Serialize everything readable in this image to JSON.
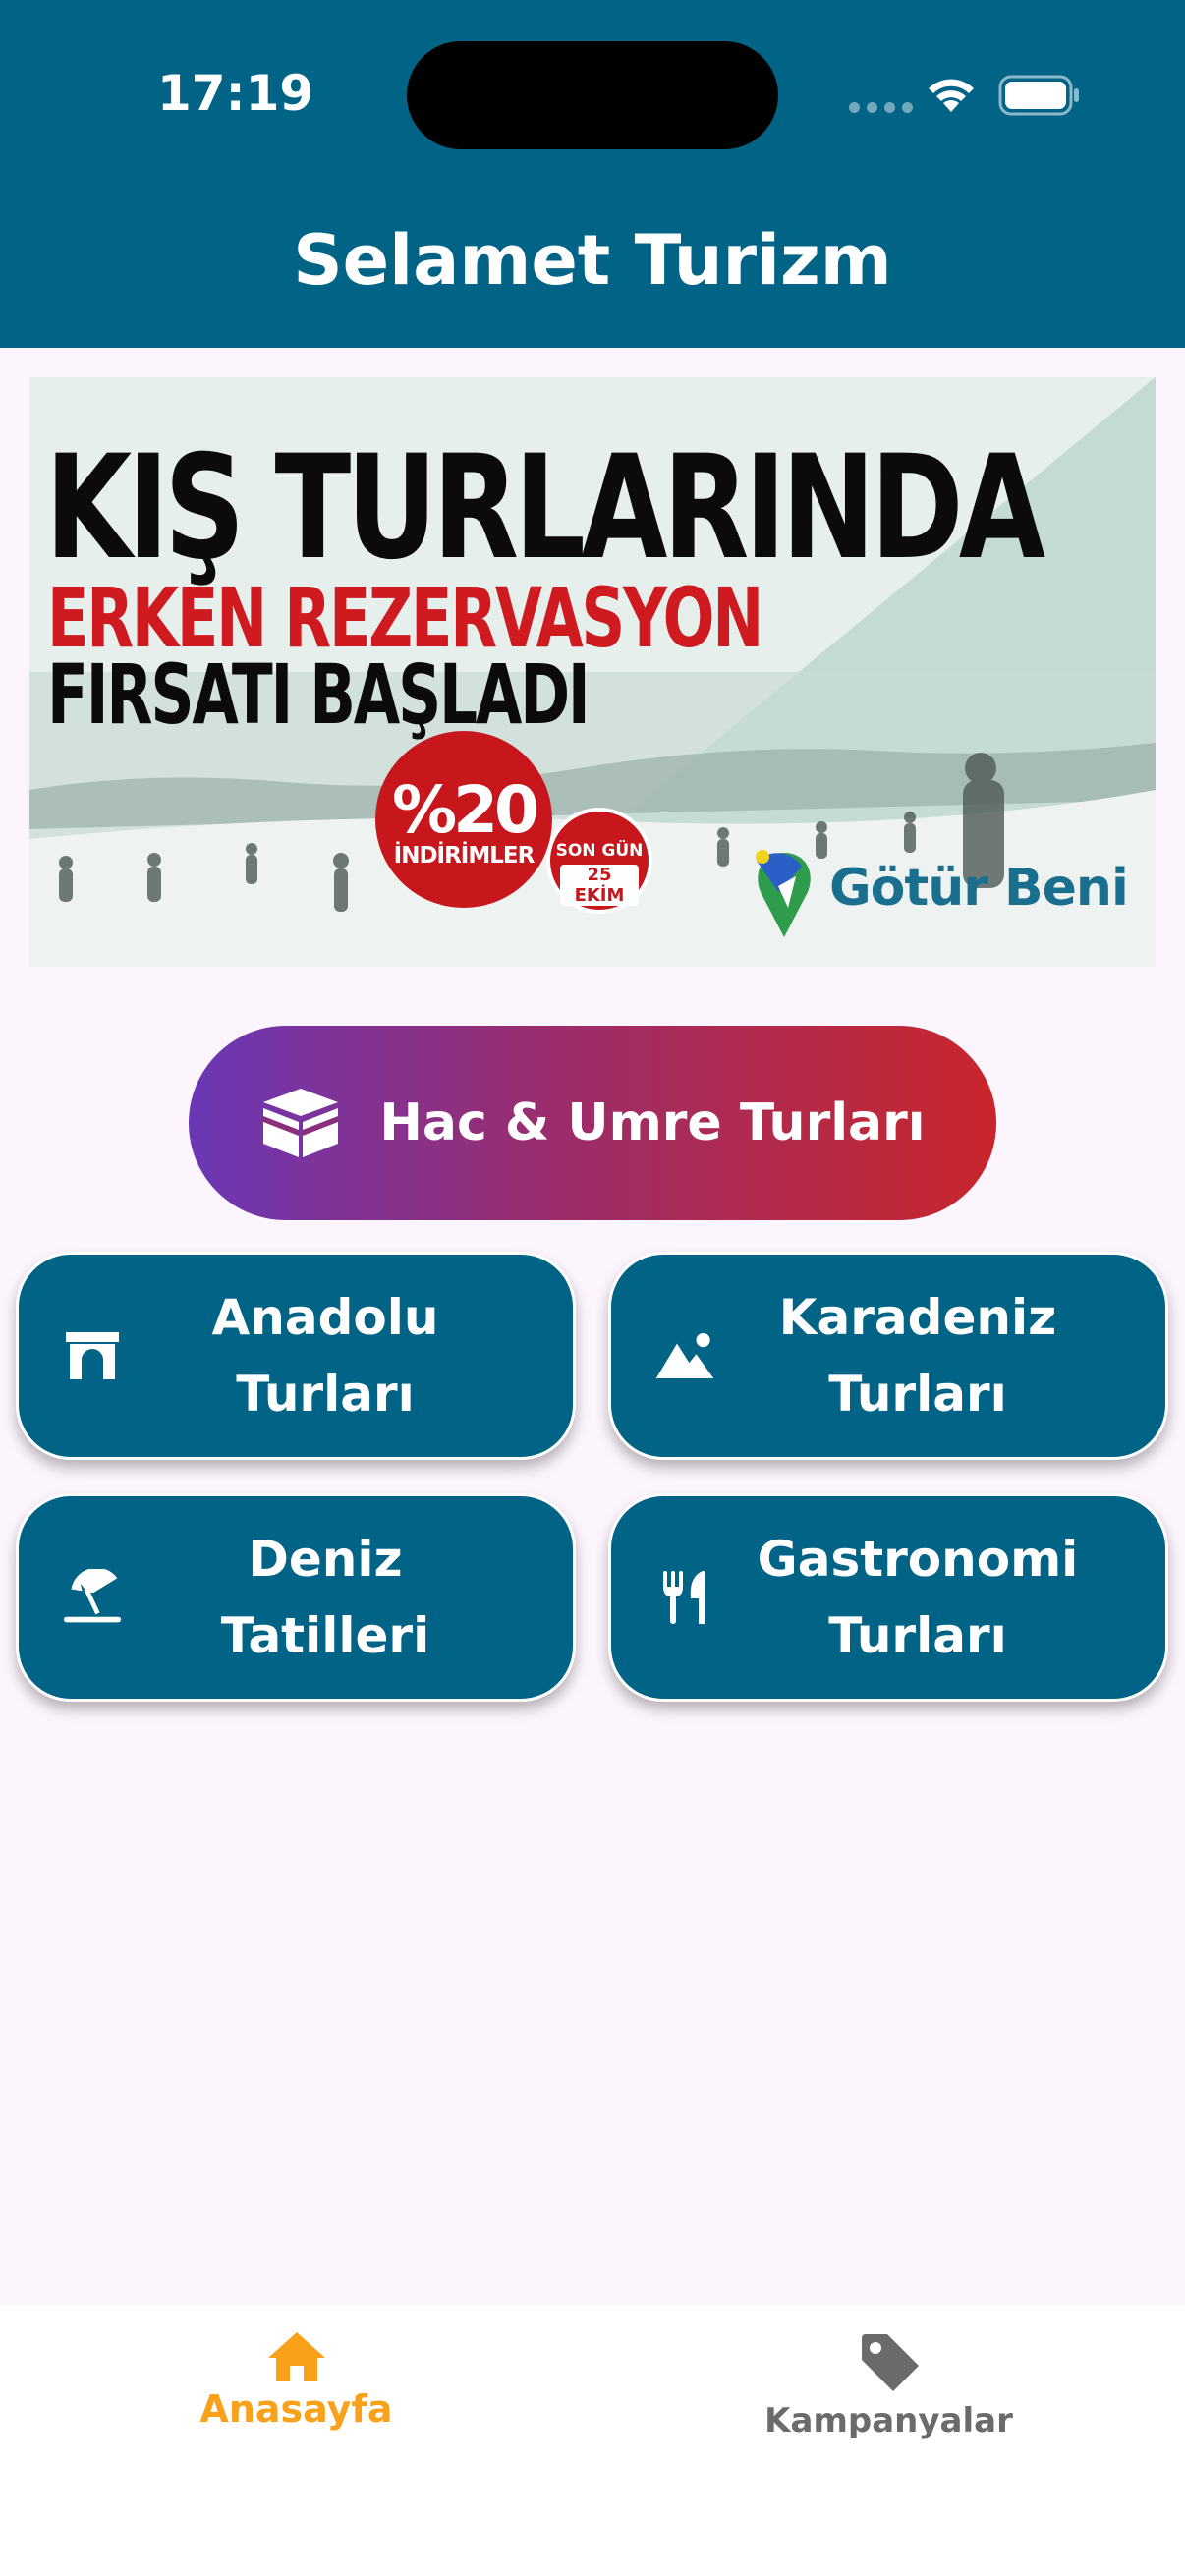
{
  "status_bar": {
    "time": "17:19"
  },
  "app_bar": {
    "title": "Selamet Turizm"
  },
  "banner": {
    "headline": "KIŞ TURLARINDA",
    "subheadline_red": "ERKEN REZERVASYON",
    "subheadline_black": "FIRSATI BAŞLADI",
    "discount_value": "%20",
    "discount_label": "İNDİRİMLER",
    "deadline_line1": "SON GÜN",
    "deadline_line2": "25 EKİM",
    "brand": "Götür Beni"
  },
  "featured_button": {
    "label": "Hac & Umre Turları",
    "icon": "kaaba-icon"
  },
  "tour_cards": [
    {
      "line1": "Anadolu",
      "line2": "Turları",
      "icon": "archway-icon"
    },
    {
      "line1": "Karadeniz",
      "line2": "Turları",
      "icon": "mountain-icon"
    },
    {
      "line1": "Deniz",
      "line2": "Tatilleri",
      "icon": "beach-umbrella-icon"
    },
    {
      "line1": "Gastronomi",
      "line2": "Turları",
      "icon": "fork-knife-icon"
    }
  ],
  "tab_bar": {
    "home": {
      "label": "Anasayfa",
      "icon": "home-icon",
      "active": true
    },
    "campaigns": {
      "label": "Kampanyalar",
      "icon": "tag-icon",
      "active": false
    }
  },
  "colors": {
    "primary": "#016386",
    "background": "#fdf5fd",
    "active_tab": "#f9a11b",
    "inactive_tab": "#6b6b6b",
    "gradient_start": "#6b37b5",
    "gradient_end": "#c9262b",
    "banner_red": "#cf1a1f"
  }
}
